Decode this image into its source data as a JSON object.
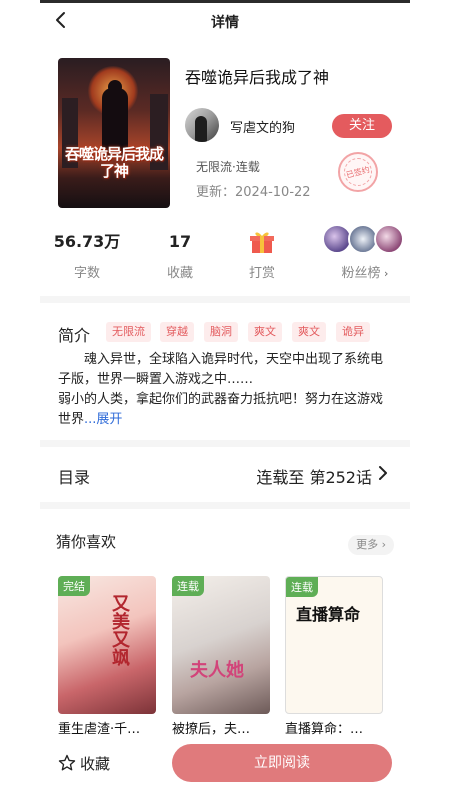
{
  "nav": {
    "title": "详情"
  },
  "book": {
    "title": "吞噬诡异后我成了神",
    "cover_title": "吞噬诡异后我成了神",
    "author": "写虐文的狗",
    "follow_label": "关注",
    "genre": "无限流·连载",
    "updated": "更新：2024-10-22",
    "signed_stamp": "已签约"
  },
  "stats": {
    "words_value": "56.73万",
    "words_label": "字数",
    "favorites_value": "17",
    "favorites_label": "收藏",
    "tip_label": "打赏",
    "fans_label": "粉丝榜"
  },
  "intro": {
    "label": "简介",
    "tags": [
      "无限流",
      "穿越",
      "脑洞",
      "爽文",
      "爽文",
      "诡异"
    ],
    "line1": "魂入异世，全球陷入诡异时代，天空中出现了系统电子版，世界一瞬置入游戏之中……",
    "line2": "弱小的人类，拿起你们的武器奋力抵抗吧！努力在这游戏世界",
    "expand": "...展开"
  },
  "toc": {
    "label": "目录",
    "status": "连载至 第252话"
  },
  "recommend": {
    "title": "猜你喜欢",
    "more": "更多",
    "items": [
      {
        "badge": "完结",
        "name": "重生虐渣·千…",
        "cover_text": "又美又飒"
      },
      {
        "badge": "连载",
        "name": "被撩后，夫…",
        "cover_text": "夫人她"
      },
      {
        "badge": "连载",
        "name": "直播算命：…",
        "cover_text": "直播算命"
      }
    ]
  },
  "bottom": {
    "favorite_label": "收藏",
    "read_label": "立即阅读"
  },
  "colors": {
    "accent": "#e45b5e",
    "read_button": "#e07a7c",
    "tag_bg": "#fdecec",
    "link": "#2f6bd8",
    "badge_green": "#5fae56"
  }
}
